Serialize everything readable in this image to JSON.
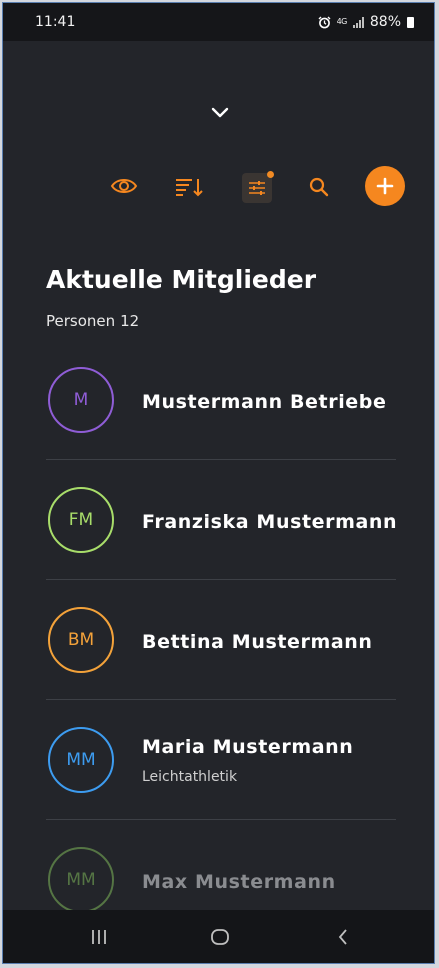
{
  "status_bar": {
    "time": "11:41",
    "network": "4G",
    "battery": "88%"
  },
  "header": {
    "title": "Aktuelle Mitglieder",
    "count_label": "Personen",
    "count": "12"
  },
  "toolbar": {
    "icons": [
      "eye-icon",
      "sort-icon",
      "filter-icon",
      "search-icon",
      "plus-icon"
    ],
    "filter_active": true,
    "accent": "#f5871f"
  },
  "members": [
    {
      "initials": "M",
      "name": "Mustermann Betriebe",
      "subtitle": "",
      "color": "#8f5dd6"
    },
    {
      "initials": "FM",
      "name": "Franziska Mustermann",
      "subtitle": "",
      "color": "#a8dd6a"
    },
    {
      "initials": "BM",
      "name": "Bettina Mustermann",
      "subtitle": "",
      "color": "#f3a23a"
    },
    {
      "initials": "MM",
      "name": "Maria Mustermann",
      "subtitle": "Leichtathletik",
      "color": "#3d9cf0"
    },
    {
      "initials": "MM",
      "name": "Max Mustermann",
      "subtitle": "",
      "color": "#7fb85a"
    }
  ],
  "nav": {
    "icons": [
      "recent-apps-icon",
      "home-icon",
      "back-icon"
    ]
  }
}
